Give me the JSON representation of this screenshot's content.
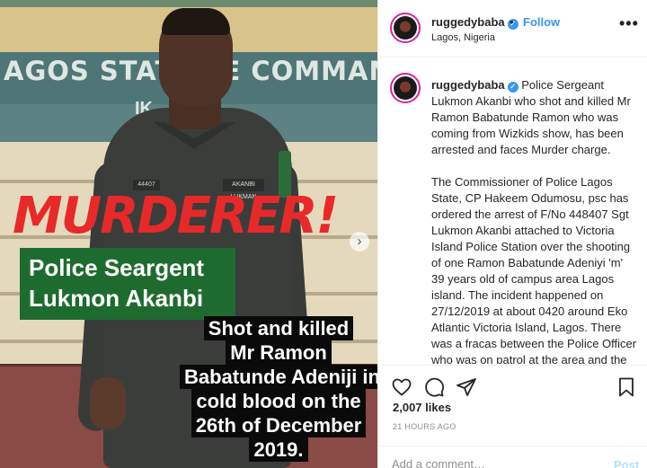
{
  "photo": {
    "sign_text": "AGOS STATE     CE COMMAN",
    "sign_text2": "IK",
    "tag_left": "44407",
    "tag_right": "AKANBI LUKMAN",
    "overlay_headline": "MURDERER!",
    "overlay_name_line1": "Police Seargent",
    "overlay_name_line2": "Lukmon Akanbi",
    "overlay_caption_lines": [
      "Shot and killed",
      "Mr Ramon",
      "Babatunde Adeniji in",
      "cold blood on the",
      "26th of December",
      "2019."
    ],
    "carousel_next_glyph": "›"
  },
  "post": {
    "username": "ruggedybaba",
    "verified_glyph": "✓",
    "separator": "•",
    "follow_label": "Follow",
    "location": "Lagos, Nigeria",
    "more_glyph": "•••",
    "caption_username": "ruggedybaba",
    "caption_p1": "Police Sergeant Lukmon Akanbi who shot and killed Mr Ramon Babatunde Ramon who was coming from Wizkids show, has been arrested and faces Murder charge.",
    "caption_p2": "The Commissioner of Police Lagos State, CP Hakeem Odumosu, psc has ordered the arrest of F/No 448407 Sgt Lukmon Akanbi attached to Victoria Island Police Station over the shooting of one Ramon Babatunde Adeniyi 'm' 39 years old of campus area Lagos island. The incident happened on 27/12/2019 at about 0420 around Eko Atlantic Victoria Island, Lagos. There was a fracas between the Police Officer who was on patrol at the area and the victim who was returning from",
    "likes": "2,007 likes",
    "timestamp": "21 HOURS AGO",
    "comment_placeholder": "Add a comment…",
    "post_label": "Post"
  },
  "icons": {
    "like": "heart-icon",
    "comment": "comment-icon",
    "share": "paper-plane-icon",
    "save": "bookmark-icon"
  },
  "colors": {
    "brand_blue": "#3897f0",
    "headline_red": "#e8292a",
    "name_box_green": "#1e6b2f"
  }
}
